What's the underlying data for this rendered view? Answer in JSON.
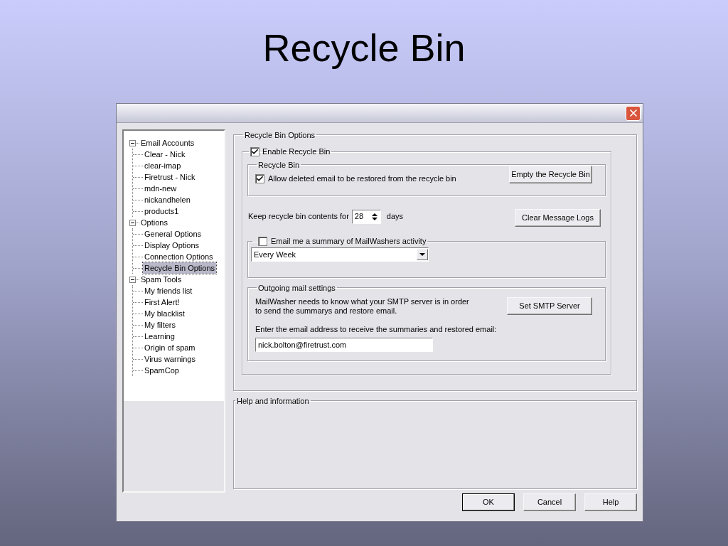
{
  "slide_title": "Recycle Bin",
  "tree": [
    {
      "label": "Email Accounts",
      "expanded": true,
      "selected": false,
      "children": [
        {
          "label": "Clear - Nick",
          "selected": false
        },
        {
          "label": "clear-imap",
          "selected": false
        },
        {
          "label": "Firetrust - Nick",
          "selected": false
        },
        {
          "label": "mdn-new",
          "selected": false
        },
        {
          "label": "nickandhelen",
          "selected": false
        },
        {
          "label": "products1",
          "selected": false
        }
      ]
    },
    {
      "label": "Options",
      "expanded": true,
      "selected": false,
      "children": [
        {
          "label": "General Options",
          "selected": false
        },
        {
          "label": "Display Options",
          "selected": false
        },
        {
          "label": "Connection Options",
          "selected": false
        },
        {
          "label": "Recycle Bin Options",
          "selected": true
        }
      ]
    },
    {
      "label": "Spam Tools",
      "expanded": true,
      "selected": false,
      "children": [
        {
          "label": "My friends list",
          "selected": false
        },
        {
          "label": "First Alert!",
          "selected": false
        },
        {
          "label": "My blacklist",
          "selected": false
        },
        {
          "label": "My filters",
          "selected": false
        },
        {
          "label": "Learning",
          "selected": false
        },
        {
          "label": "Origin of spam",
          "selected": false
        },
        {
          "label": "Virus warnings",
          "selected": false
        },
        {
          "label": "SpamCop",
          "selected": false
        }
      ]
    }
  ],
  "options_group": {
    "title": "Recycle Bin Options",
    "enable": {
      "label": "Enable Recycle Bin",
      "checked": true
    },
    "recycle_bin_group": {
      "title": "Recycle Bin",
      "allow": {
        "label": "Allow deleted email to be restored from the recycle bin",
        "checked": true
      },
      "empty_button": "Empty the Recycle Bin"
    },
    "keep": {
      "label_before": "Keep recycle bin contents for",
      "value": "28",
      "label_after": "days"
    },
    "clear_logs_button": "Clear Message Logs",
    "summary": {
      "label": "Email me a summary of MailWashers activity",
      "checked": false,
      "frequency": "Every Week"
    },
    "outgoing": {
      "title": "Outgoing mail settings",
      "description": [
        "MailWasher needs to know what your SMTP server is in order",
        "to send the summarys and restore email."
      ],
      "button": "Set SMTP Server",
      "email_label": "Enter the email address to receive the summaries and restored email:",
      "email_value": "nick.bolton@firetrust.com"
    }
  },
  "help_group": {
    "title": "Help and information"
  },
  "buttons": [
    {
      "label": "OK",
      "default": true
    },
    {
      "label": "Cancel",
      "default": false
    },
    {
      "label": "Help",
      "default": false
    }
  ]
}
